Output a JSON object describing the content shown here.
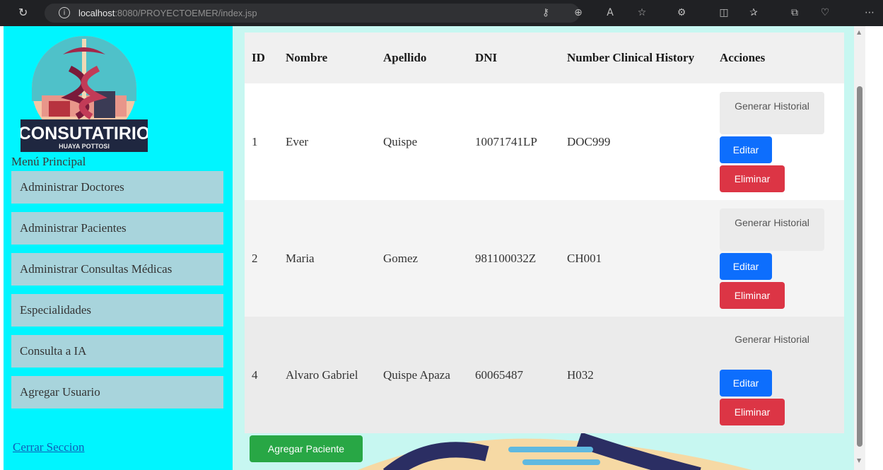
{
  "browser": {
    "url_host": "localhost",
    "url_rest": ":8080/PROYECTOEMER/index.jsp"
  },
  "sidebar": {
    "logo_text": "CONSUTATIRIO",
    "logo_subtext": "HUAYA POTTOSI",
    "menu_title": "Menú Principal",
    "items": [
      {
        "label": "Administrar Doctores"
      },
      {
        "label": "Administrar Pacientes"
      },
      {
        "label": "Administrar Consultas Médicas"
      },
      {
        "label": "Especialidades"
      },
      {
        "label": "Consulta a IA"
      },
      {
        "label": "Agregar Usuario"
      }
    ],
    "logout": "Cerrar Seccion"
  },
  "table": {
    "headers": [
      "ID",
      "Nombre",
      "Apellido",
      "DNI",
      "Number Clinical History",
      "Acciones"
    ],
    "rows": [
      {
        "id": "1",
        "nombre": "Ever",
        "apellido": "Quispe",
        "dni": "10071741LP",
        "history": "DOC999"
      },
      {
        "id": "2",
        "nombre": "Maria",
        "apellido": "Gomez",
        "dni": "981100032Z",
        "history": "CH001"
      },
      {
        "id": "4",
        "nombre": "Alvaro Gabriel",
        "apellido": "Quispe Apaza",
        "dni": "60065487",
        "history": "H032"
      }
    ],
    "actions": {
      "history": "Generar Historial",
      "edit": "Editar",
      "delete": "Eliminar"
    }
  },
  "add_button": "Agregar Paciente",
  "colors": {
    "sidebar_bg": "#00f5ff",
    "nav_item_bg": "#a8d4dc",
    "main_bg": "#c7f7f1",
    "edit": "#0d6efd",
    "delete": "#dc3545",
    "add": "#28a745"
  }
}
